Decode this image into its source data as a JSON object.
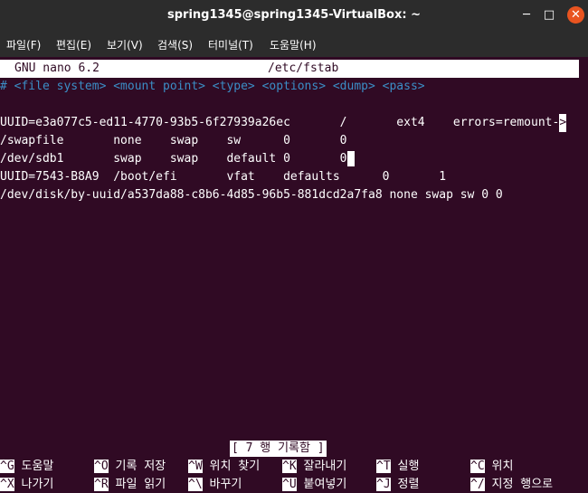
{
  "window": {
    "title": "spring1345@spring1345-VirtualBox: ~",
    "minimize_glyph": "─",
    "maximize_glyph": "□",
    "close_glyph": "✕"
  },
  "menu": [
    {
      "label": "파일(F)"
    },
    {
      "label": "편집(E)"
    },
    {
      "label": "보기(V)"
    },
    {
      "label": "검색(S)"
    },
    {
      "label": "터미널(T)"
    },
    {
      "label": "도움말(H)"
    }
  ],
  "nano": {
    "version": "GNU nano 6.2",
    "filename": "/etc/fstab"
  },
  "editor": {
    "comment_line": "# <file system> <mount point> <type> <options> <dump> <pass>",
    "line_uuid_root": "UUID=e3a077c5-ed11-4770-93b5-6f27939a26ec       /       ext4    errors=remount-",
    "line_uuid_root_more": ">",
    "line_swapfile": "/swapfile       none    swap    sw      0       0",
    "line_sdb1": "/dev/sdb1       swap    swap    default 0       0",
    "line_efi": "UUID=7543-B8A9  /boot/efi       vfat    defaults      0       1",
    "line_disk": "/dev/disk/by-uuid/a537da88-c8b6-4d85-96b5-881dcd2a7fa8 none swap sw 0 0"
  },
  "status_message": "[ 7 행 기록함 ]",
  "shortcuts": [
    {
      "key": "^G",
      "label": "도움말"
    },
    {
      "key": "^O",
      "label": "기록 저장"
    },
    {
      "key": "^W",
      "label": "위치 찾기"
    },
    {
      "key": "^K",
      "label": "잘라내기"
    },
    {
      "key": "^T",
      "label": "실행"
    },
    {
      "key": "^C",
      "label": "위치"
    },
    {
      "key": "^X",
      "label": "나가기"
    },
    {
      "key": "^R",
      "label": "파일 읽기"
    },
    {
      "key": "^\\",
      "label": "바꾸기"
    },
    {
      "key": "^U",
      "label": "붙여넣기"
    },
    {
      "key": "^J",
      "label": "정렬"
    },
    {
      "key": "^/",
      "label": "지정 행으로"
    }
  ],
  "colors": {
    "terminal_bg": "#300a24",
    "titlebar_bg": "#2c2c2c",
    "comment": "#3b8ec6",
    "close_button": "#e95420"
  }
}
